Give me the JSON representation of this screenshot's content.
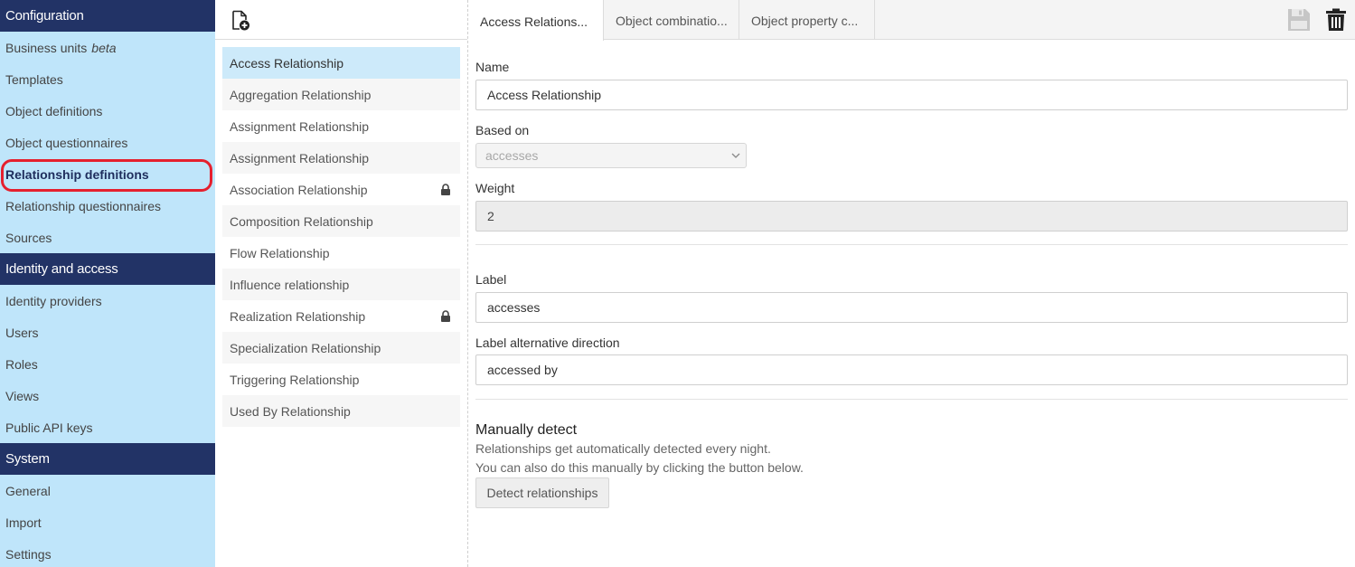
{
  "sidebar": {
    "sections": [
      {
        "title": "Configuration",
        "items": [
          "Business units",
          "Templates",
          "Object definitions",
          "Object questionnaires",
          "Relationship definitions",
          "Relationship questionnaires",
          "Sources"
        ]
      },
      {
        "title": "Identity and access",
        "items": [
          "Identity providers",
          "Users",
          "Roles",
          "Views",
          "Public API keys"
        ]
      },
      {
        "title": "System",
        "items": [
          "General",
          "Import",
          "Settings"
        ]
      }
    ],
    "beta_tag": "beta",
    "active_item": "Relationship definitions"
  },
  "list": {
    "new_icon": "add-document-icon",
    "items": [
      {
        "label": "Access Relationship",
        "locked": false
      },
      {
        "label": "Aggregation Relationship",
        "locked": false
      },
      {
        "label": "Assignment Relationship",
        "locked": false
      },
      {
        "label": "Assignment Relationship",
        "locked": false
      },
      {
        "label": "Association Relationship",
        "locked": true
      },
      {
        "label": "Composition Relationship",
        "locked": false
      },
      {
        "label": "Flow Relationship",
        "locked": false
      },
      {
        "label": "Influence relationship",
        "locked": false
      },
      {
        "label": "Realization Relationship",
        "locked": true
      },
      {
        "label": "Specialization Relationship",
        "locked": false
      },
      {
        "label": "Triggering Relationship",
        "locked": false
      },
      {
        "label": "Used By Relationship",
        "locked": false
      }
    ],
    "selected_index": 0
  },
  "detail": {
    "tabs": [
      "Access Relations...",
      "Object combinatio...",
      "Object property c..."
    ],
    "active_tab": 0,
    "toolbar": {
      "save_icon": "save-icon",
      "delete_icon": "trash-icon"
    },
    "form": {
      "name_label": "Name",
      "name_value": "Access Relationship",
      "based_on_label": "Based on",
      "based_on_value": "accesses",
      "weight_label": "Weight",
      "weight_value": "2",
      "label_label": "Label",
      "label_value": "accesses",
      "label_alt_label": "Label alternative direction",
      "label_alt_value": "accessed by"
    },
    "detect": {
      "title": "Manually detect",
      "line1": "Relationships get automatically detected every night.",
      "line2": "You can also do this manually by clicking the button below.",
      "button": "Detect relationships"
    }
  },
  "colors": {
    "sidebar_bg": "#bfe5fa",
    "section_header": "#223366",
    "selected_item": "#cdeafa",
    "highlight_ring": "#e5202e"
  }
}
